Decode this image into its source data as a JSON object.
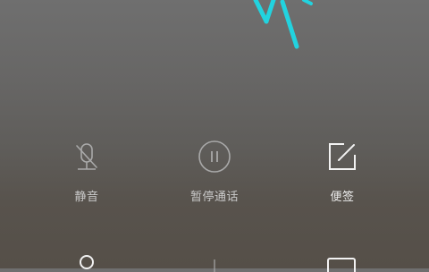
{
  "call_controls": {
    "mute": {
      "label": "静音",
      "icon": "mic-off-icon",
      "enabled": false
    },
    "hold": {
      "label": "暂停通话",
      "icon": "pause-icon",
      "enabled": false
    },
    "memo": {
      "label": "便签",
      "icon": "note-edit-icon",
      "enabled": true
    }
  },
  "second_row": {
    "icons": [
      "person-icon",
      "divider",
      "dialpad-icon"
    ]
  },
  "colors": {
    "accent": "#22d3df",
    "enabled_icon": "#f2f2f2",
    "disabled_icon": "#a9a9a9"
  }
}
